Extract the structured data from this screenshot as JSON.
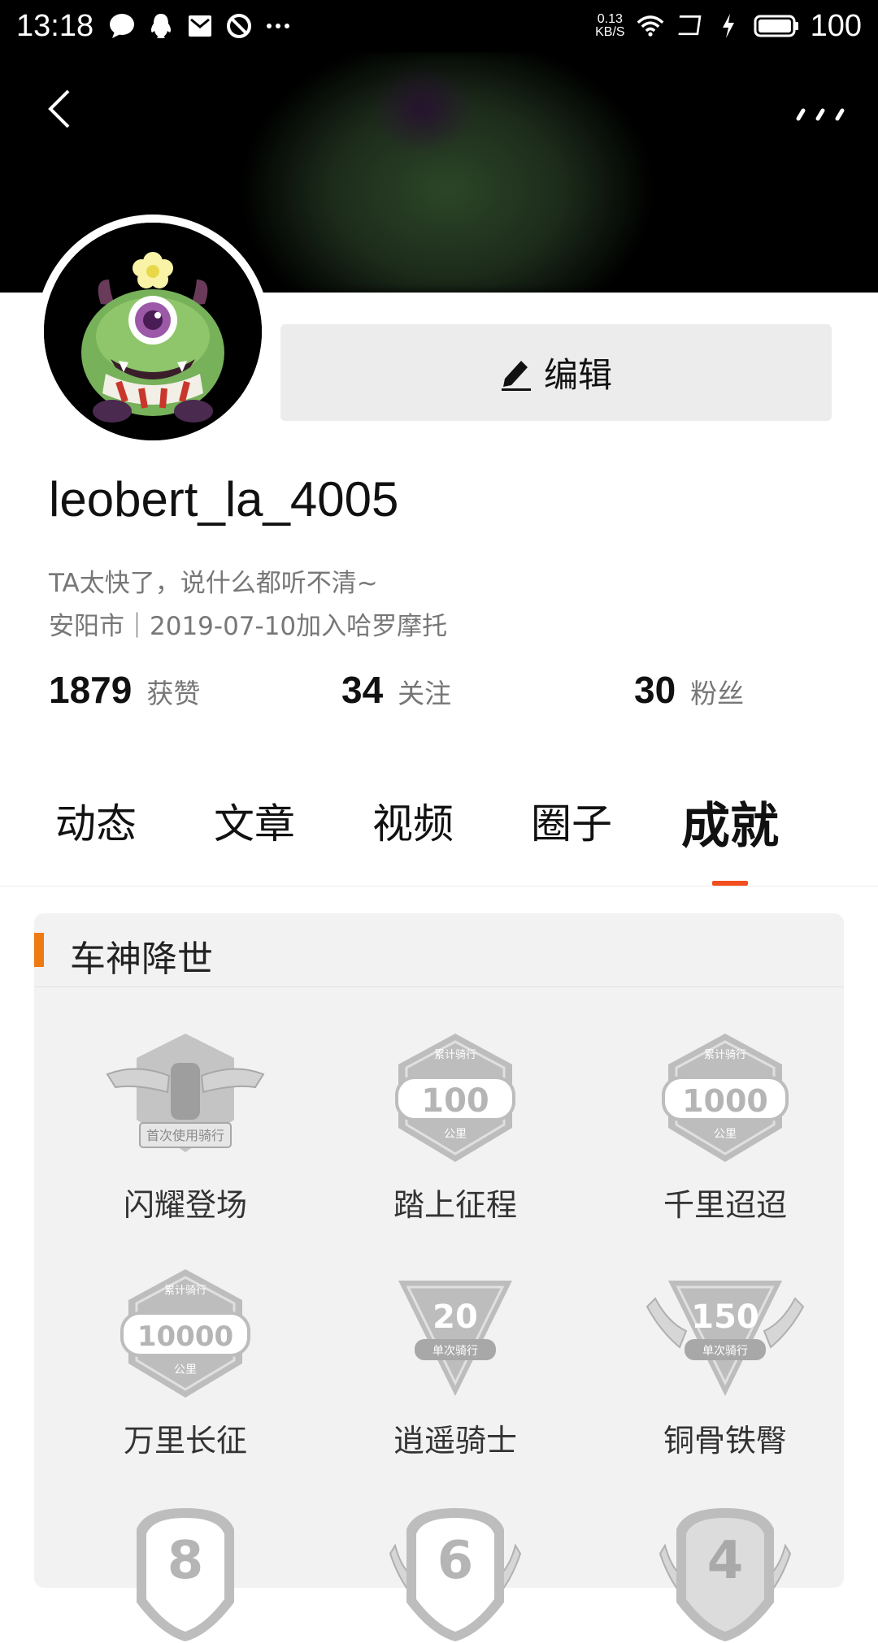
{
  "status_bar": {
    "time": "13:18",
    "speed_value": "0.13",
    "speed_unit": "KB/S",
    "battery": "100",
    "icons": [
      "chat-bubble-icon",
      "qq-icon",
      "mail-icon",
      "blocked-icon",
      "more-dots-icon",
      "wifi-icon",
      "cast-icon",
      "charging-icon",
      "battery-icon"
    ]
  },
  "header": {
    "back_icon": "chevron-left-icon",
    "more_icon": "more-dots-icon"
  },
  "profile": {
    "edit_label": "编辑",
    "username": "leobert_la_4005",
    "bio": "TA太快了，说什么都听不清~",
    "meta": "安阳市｜2019-07-10加入哈罗摩托",
    "stats": [
      {
        "value": "1879",
        "label": "获赞"
      },
      {
        "value": "34",
        "label": "关注"
      },
      {
        "value": "30",
        "label": "粉丝"
      }
    ]
  },
  "tabs": [
    {
      "label": "动态",
      "active": false
    },
    {
      "label": "文章",
      "active": false
    },
    {
      "label": "视频",
      "active": false
    },
    {
      "label": "圈子",
      "active": false
    },
    {
      "label": "成就",
      "active": true
    }
  ],
  "achievements": {
    "section_title": "车神降世",
    "badges": [
      {
        "label": "闪耀登场",
        "icon": "first-ride-wings-badge",
        "text": "首次使用骑行"
      },
      {
        "label": "踏上征程",
        "icon": "distance-badge",
        "top": "累计骑行",
        "value": "100",
        "unit": "公里"
      },
      {
        "label": "千里迢迢",
        "icon": "distance-badge",
        "top": "累计骑行",
        "value": "1000",
        "unit": "公里"
      },
      {
        "label": "万里长征",
        "icon": "distance-badge",
        "top": "累计骑行",
        "value": "10000",
        "unit": "公里"
      },
      {
        "label": "逍遥骑士",
        "icon": "single-ride-badge",
        "value": "20",
        "unit": "单次骑行"
      },
      {
        "label": "铜骨铁臀",
        "icon": "single-ride-wings-badge",
        "value": "150",
        "unit": "单次骑行"
      }
    ],
    "partial_badges": [
      {
        "value": "8",
        "icon": "shield-badge"
      },
      {
        "value": "6",
        "icon": "shield-badge"
      },
      {
        "value": "4",
        "icon": "shield-badge"
      }
    ]
  },
  "colors": {
    "accent_tab": "#f24e1e",
    "section_accent": "#f07a12",
    "badge_gray": "#bdbdbd"
  }
}
